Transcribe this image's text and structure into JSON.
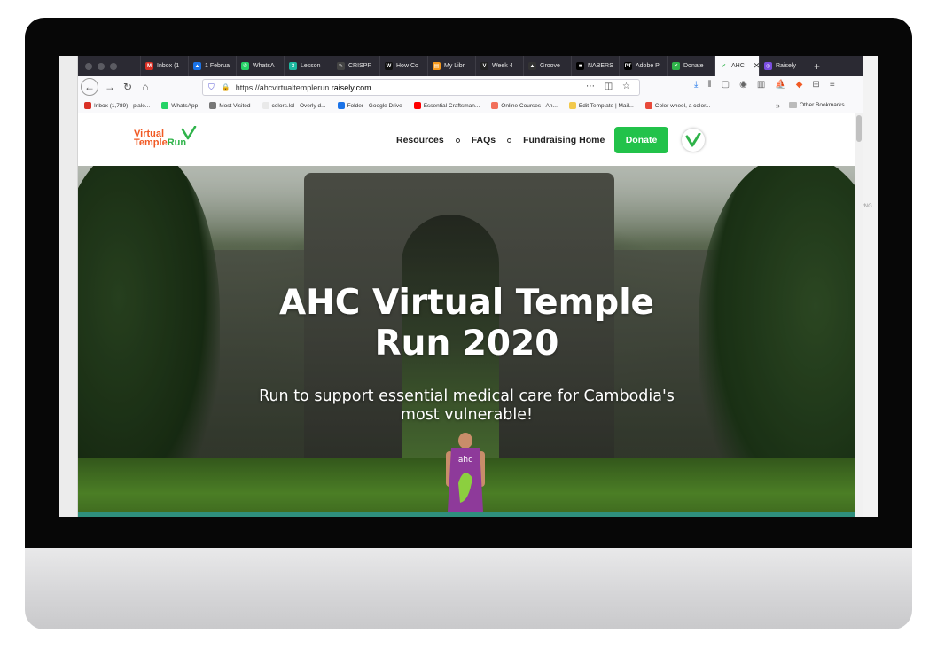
{
  "browser": {
    "tabs": [
      {
        "label": "Inbox (1",
        "fav_color": "#d93025",
        "fav_glyph": "M"
      },
      {
        "label": "1 Februa",
        "fav_color": "#1a73e8",
        "fav_glyph": "▲"
      },
      {
        "label": "WhatsA",
        "fav_color": "#25d366",
        "fav_glyph": "✆"
      },
      {
        "label": "Lesson",
        "fav_color": "#1db9a0",
        "fav_glyph": "3"
      },
      {
        "label": "CRISPR",
        "fav_color": "#444444",
        "fav_glyph": "✎"
      },
      {
        "label": "How Co",
        "fav_color": "#111111",
        "fav_glyph": "W"
      },
      {
        "label": "My Libr",
        "fav_color": "#f79a1e",
        "fav_glyph": "▤"
      },
      {
        "label": "Week 4",
        "fav_color": "#222222",
        "fav_glyph": "V"
      },
      {
        "label": "Groove",
        "fav_color": "#333333",
        "fav_glyph": "▲"
      },
      {
        "label": "NABERS",
        "fav_color": "#000000",
        "fav_glyph": "■"
      },
      {
        "label": "Adobe P",
        "fav_color": "#000000",
        "fav_glyph": "PT"
      },
      {
        "label": "Donate",
        "fav_color": "#2fb34a",
        "fav_glyph": "✔"
      },
      {
        "label": "AHC",
        "fav_color": "#2fb34a",
        "fav_glyph": "✔",
        "active": true
      },
      {
        "label": "Raisely",
        "fav_color": "#7b4ee0",
        "fav_glyph": "◎"
      }
    ],
    "url_prefix": "https://ahcvirtualtemplerun.",
    "url_domain": "raisely.com",
    "bookmarks": [
      {
        "label": "Inbox (1,789) - piale...",
        "color": "#d93025"
      },
      {
        "label": "WhatsApp",
        "color": "#25d366"
      },
      {
        "label": "Most Visited",
        "color": "#777777"
      },
      {
        "label": "colors.lol - Overly d...",
        "color": "#e9e9e9"
      },
      {
        "label": "Folder - Google Drive",
        "color": "#1a73e8"
      },
      {
        "label": "Essential Craftsman...",
        "color": "#ff0000"
      },
      {
        "label": "Online Courses - An...",
        "color": "#f26f5a"
      },
      {
        "label": "Edit Template | Mail...",
        "color": "#f2c94c"
      },
      {
        "label": "Color wheel, a color...",
        "color": "#e84a3a"
      }
    ],
    "other_bookmarks": "Other Bookmarks"
  },
  "site": {
    "logo_line1": "Virtual",
    "logo_line2a": "Temple",
    "logo_line2b": "Run",
    "nav": [
      "Resources",
      "FAQs",
      "Fundraising Home"
    ],
    "donate_label": "Donate",
    "brand_green": "#22c24a",
    "brand_orange": "#f15a24"
  },
  "hero": {
    "title_line1": "AHC Virtual Temple",
    "title_line2": "Run 2020",
    "subtitle_line1": "Run to support essential medical care for Cambodia's",
    "subtitle_line2": "most vulnerable!",
    "shirt_text": "ahc"
  },
  "desktop": {
    "file_label": "PNG"
  }
}
